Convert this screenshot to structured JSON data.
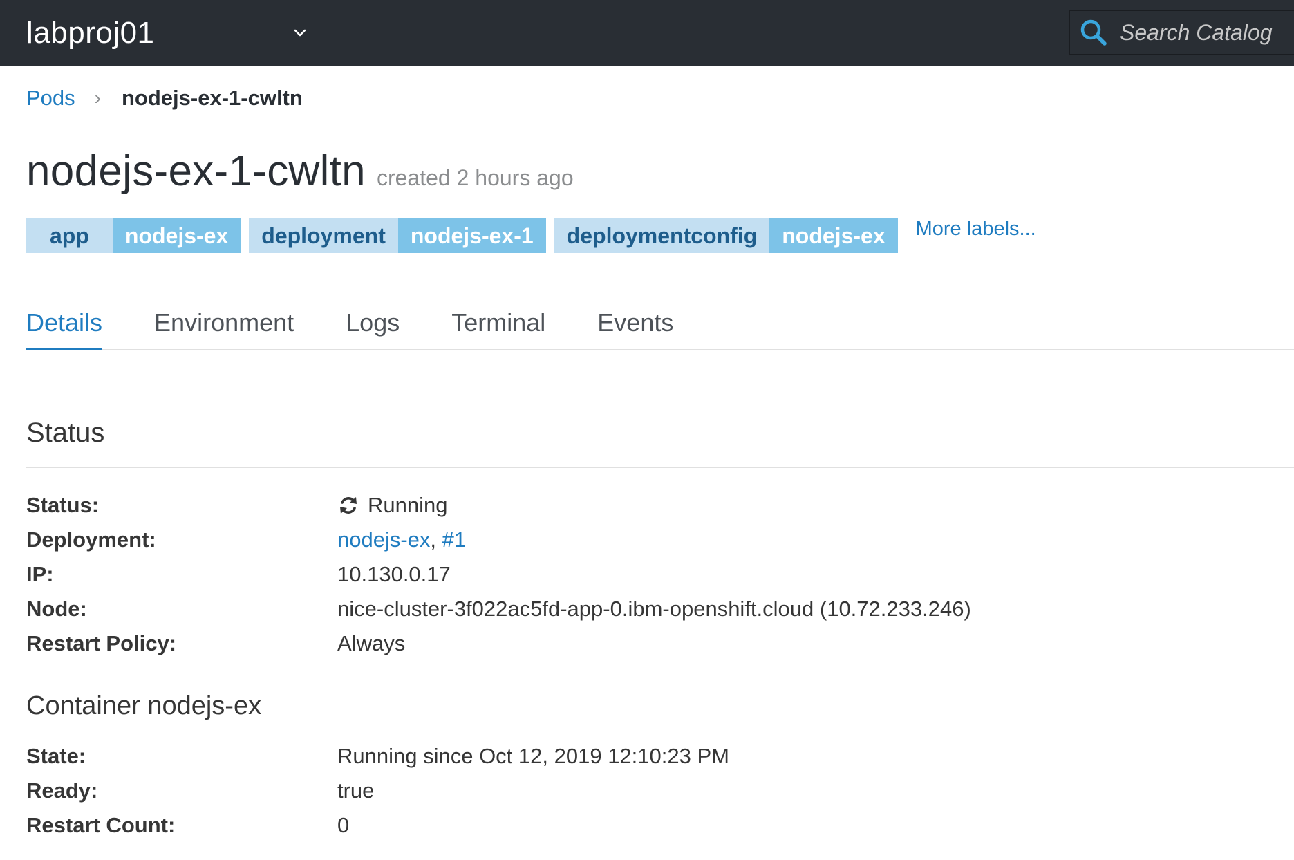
{
  "topbar": {
    "project_name": "labproj01",
    "search_placeholder": "Search Catalog"
  },
  "breadcrumb": {
    "parent": "Pods",
    "separator": "›",
    "current": "nodejs-ex-1-cwltn"
  },
  "header": {
    "title": "nodejs-ex-1-cwltn",
    "created": "created 2 hours ago"
  },
  "labels": [
    {
      "key": "app",
      "value": "nodejs-ex"
    },
    {
      "key": "deployment",
      "value": "nodejs-ex-1"
    },
    {
      "key": "deploymentconfig",
      "value": "nodejs-ex"
    }
  ],
  "more_labels": "More labels...",
  "tabs": [
    {
      "label": "Details",
      "active": true
    },
    {
      "label": "Environment",
      "active": false
    },
    {
      "label": "Logs",
      "active": false
    },
    {
      "label": "Terminal",
      "active": false
    },
    {
      "label": "Events",
      "active": false
    }
  ],
  "status_section": {
    "heading": "Status",
    "rows": {
      "status": {
        "term": "Status:",
        "value": "Running",
        "icon": "refresh-icon"
      },
      "deployment": {
        "term": "Deployment:",
        "link1": "nodejs-ex",
        "sep": ", ",
        "link2": "#1"
      },
      "ip": {
        "term": "IP:",
        "value": "10.130.0.17"
      },
      "node": {
        "term": "Node:",
        "value": "nice-cluster-3f022ac5fd-app-0.ibm-openshift.cloud (10.72.233.246)"
      },
      "restart_policy": {
        "term": "Restart Policy:",
        "value": "Always"
      }
    }
  },
  "container_section": {
    "heading": "Container nodejs-ex",
    "rows": {
      "state": {
        "term": "State:",
        "value": "Running since Oct 12, 2019 12:10:23 PM"
      },
      "ready": {
        "term": "Ready:",
        "value": "true"
      },
      "restart_count": {
        "term": "Restart Count:",
        "value": "0"
      }
    }
  },
  "colors": {
    "topbar_bg": "#292e34",
    "link": "#1f7cc0",
    "label_key_bg": "#c3dff2",
    "label_value_bg": "#7dc3e8",
    "search_icon": "#39a5dc"
  }
}
